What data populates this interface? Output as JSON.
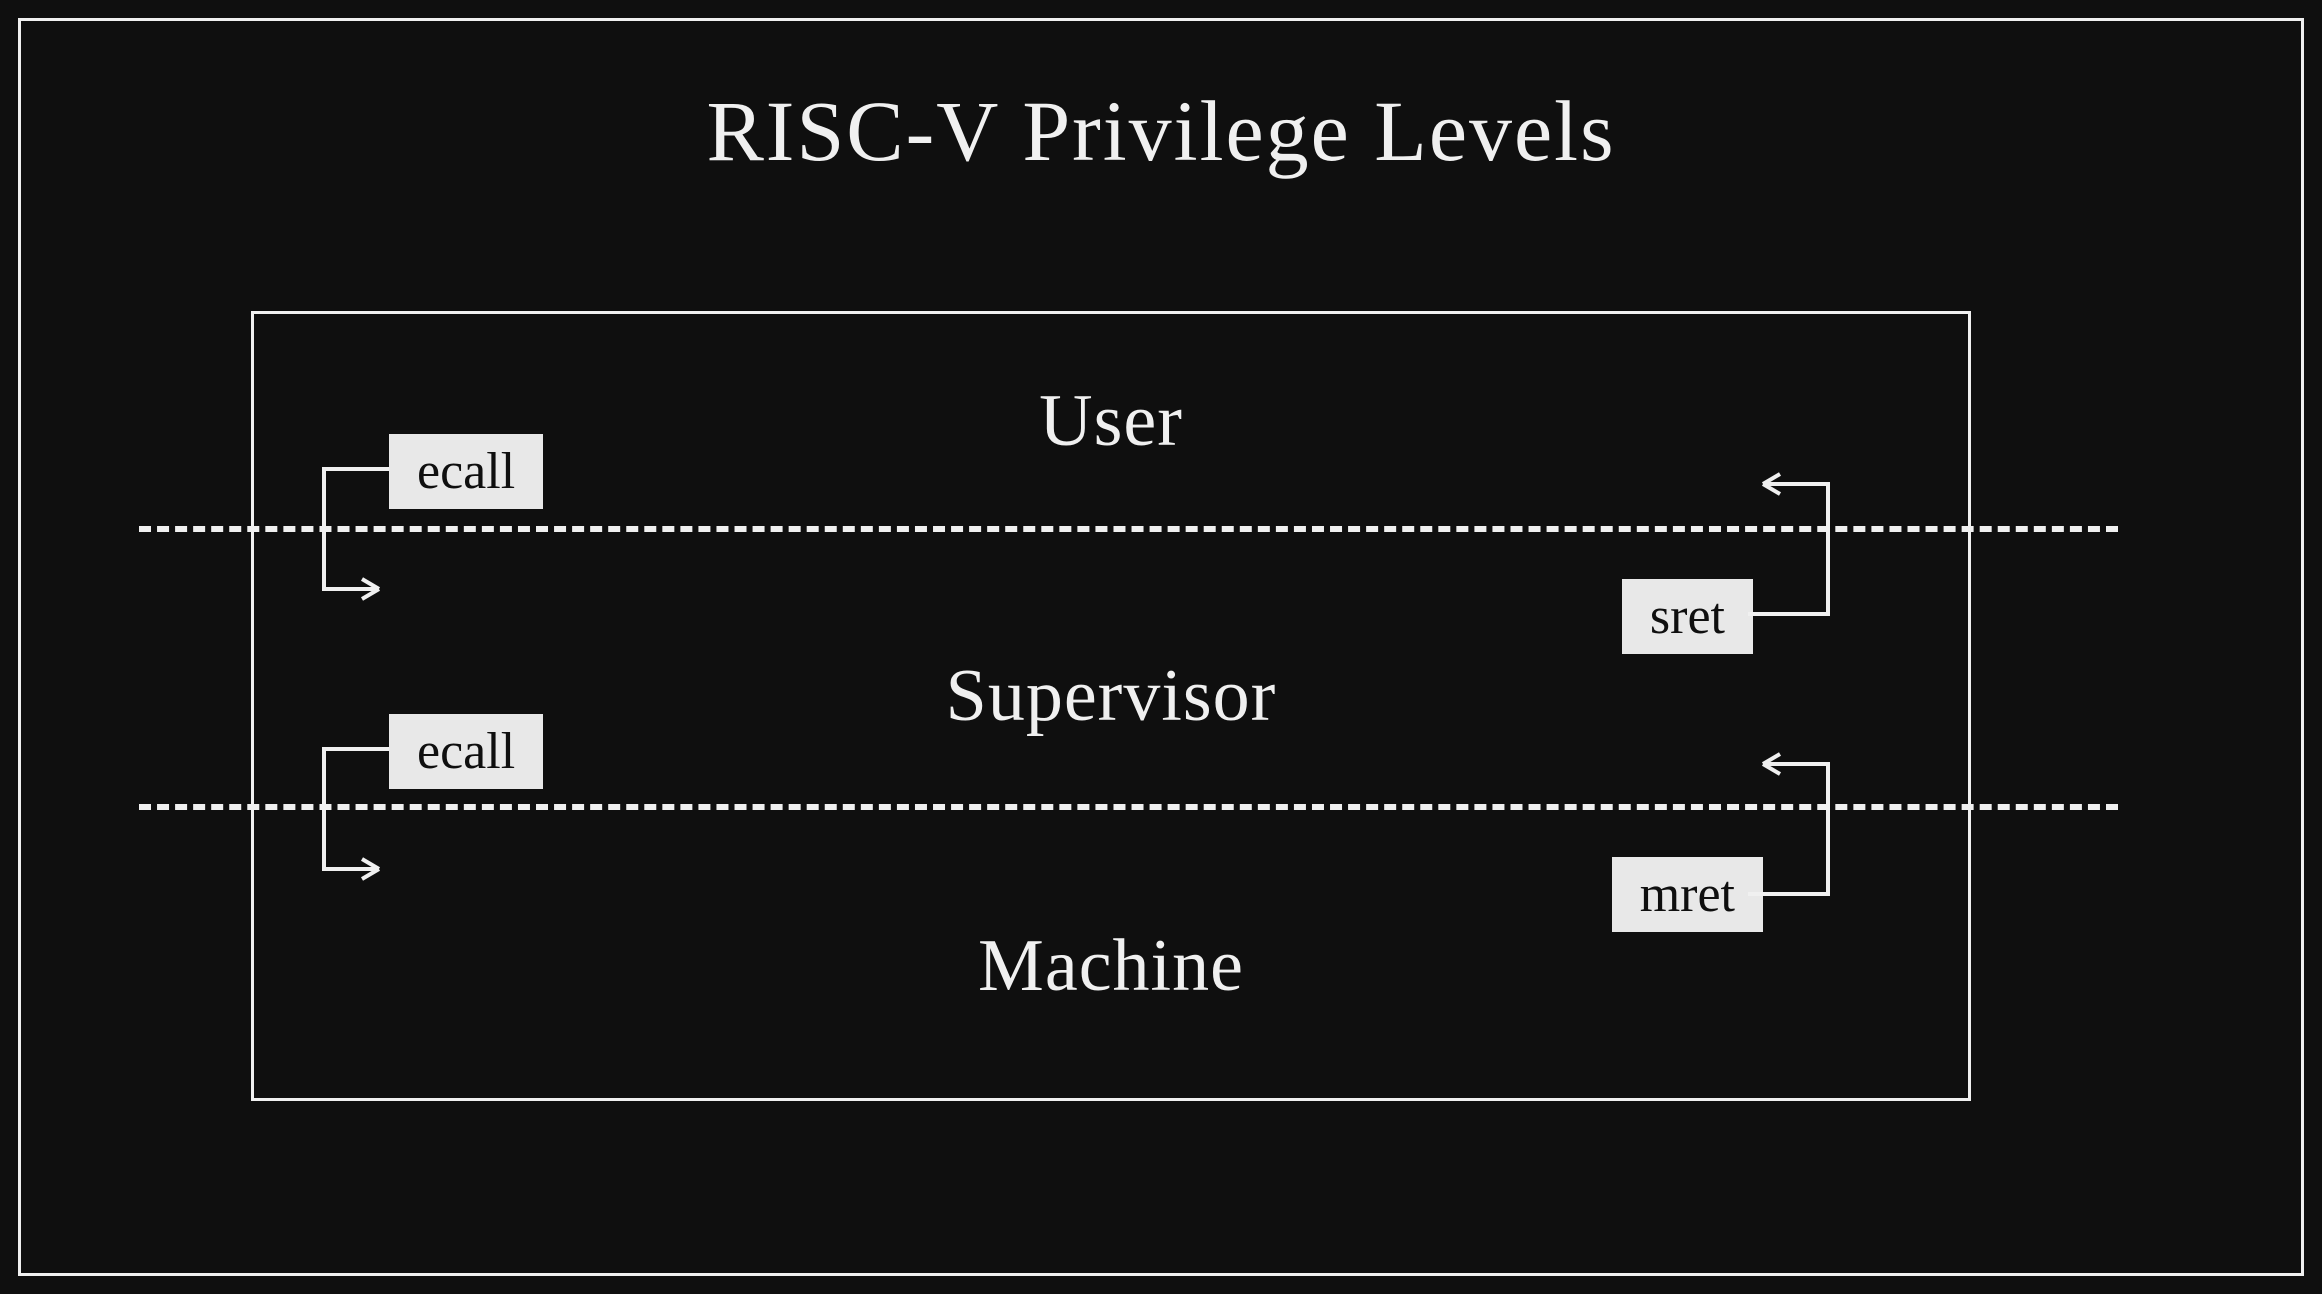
{
  "title": "RISC-V Privilege Levels",
  "levels": {
    "user": "User",
    "supervisor": "Supervisor",
    "machine": "Machine"
  },
  "instructions": {
    "ecall_user_to_supervisor": "ecall",
    "ecall_supervisor_to_machine": "ecall",
    "sret": "sret",
    "mret": "mret"
  }
}
